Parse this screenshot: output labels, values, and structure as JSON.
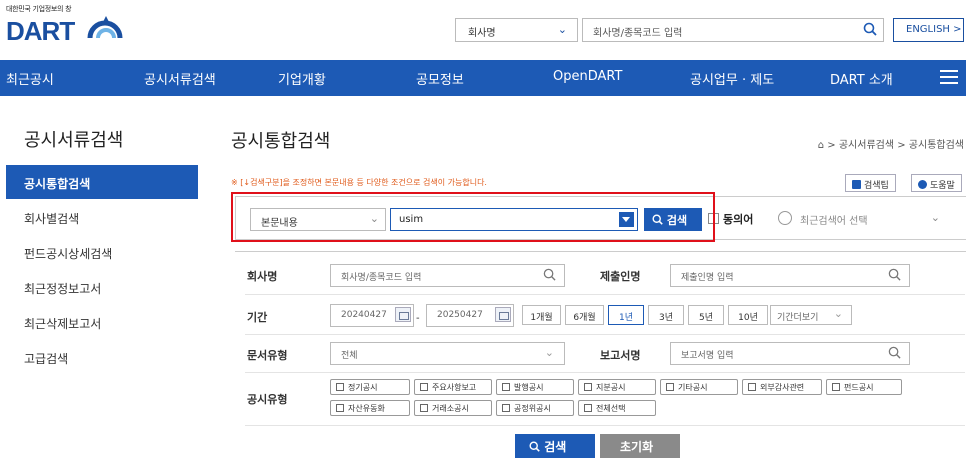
{
  "header": {
    "logo_small": "대한민국 기업정보의 창",
    "logo": "DART",
    "company_select": "회사명",
    "search_placeholder": "회사명/종목코드 입력",
    "english_button": "ENGLISH >"
  },
  "nav": {
    "items": [
      "최근공시",
      "공시서류검색",
      "기업개황",
      "공모정보",
      "OpenDART",
      "공시업무 · 제도",
      "DART 소개"
    ]
  },
  "sidebar": {
    "title": "공시서류검색",
    "items": [
      "공시통합검색",
      "회사별검색",
      "펀드공시상세검색",
      "최근정정보고서",
      "최근삭제보고서",
      "고급검색"
    ]
  },
  "main": {
    "title": "공시통합검색",
    "breadcrumb": "공시서류검색 > 공시통합검색",
    "notice": "※ [↓검색구분]을 조정하면 본문내용 등 다양한 조건으로 검색이 가능합니다.",
    "tip_button": "검색팁",
    "help_button": "도움말"
  },
  "search_row": {
    "search_type": "본문내용",
    "keyword": "usim",
    "search_button": "검색",
    "synonym_label": "동의어",
    "recent_placeholder": "최근검색어 선택"
  },
  "form": {
    "company_label": "회사명",
    "company_placeholder": "회사명/종목코드 입력",
    "submitter_label": "제출인명",
    "submitter_placeholder": "제출인명 입력",
    "period_label": "기간",
    "date_from": "20240427",
    "date_to": "20250427",
    "period_buttons": [
      "1개월",
      "6개월",
      "1년",
      "3년",
      "5년",
      "10년"
    ],
    "period_selected": "1년",
    "period_more": "기간더보기",
    "doctype_label": "문서유형",
    "doctype_value": "전체",
    "report_label": "보고서명",
    "report_placeholder": "보고서명 입력",
    "disclosure_label": "공시유형",
    "disclosure_types": [
      "정기공시",
      "주요사항보고",
      "발행공시",
      "지분공시",
      "기타공시",
      "외부감사관련",
      "펀드공시",
      "자산유동화",
      "거래소공시",
      "공정위공시",
      "전체선택"
    ],
    "submit_button": "검색",
    "reset_button": "초기화"
  },
  "colors": {
    "brand_blue": "#1d5ab5",
    "highlight_red": "#e0101a",
    "notice_orange": "#e05a1a"
  }
}
